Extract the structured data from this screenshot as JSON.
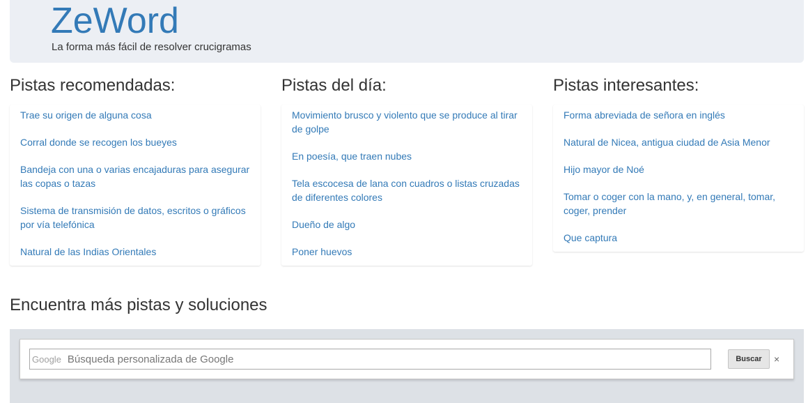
{
  "header": {
    "brand": "ZeWord",
    "tagline": "La forma más fácil de resolver crucigramas"
  },
  "columns": [
    {
      "title": "Pistas recomendadas:",
      "items": [
        "Trae su origen de alguna cosa",
        "Corral donde se recogen los bueyes",
        "Bandeja con una o varias encajaduras para asegurar las copas o tazas",
        "Sistema de transmisión de datos, escritos o gráficos por vía telefónica",
        "Natural de las Indias Orientales"
      ]
    },
    {
      "title": "Pistas del día:",
      "items": [
        "Movimiento brusco y violento que se produce al tirar de golpe",
        "En poesía, que traen nubes",
        "Tela escocesa de lana con cuadros o listas cruzadas de diferentes colores",
        "Dueño de algo",
        "Poner huevos"
      ]
    },
    {
      "title": "Pistas interesantes:",
      "items": [
        "Forma abreviada de señora en inglés",
        "Natural de Nicea, antigua ciudad de Asia Menor",
        "Hijo mayor de Noé",
        "Tomar o coger con la mano, y, en general, tomar, coger, prender",
        "Que captura"
      ]
    }
  ],
  "more": {
    "title": "Encuentra más pistas y soluciones"
  },
  "search": {
    "watermark": "Google",
    "placeholder": "Búsqueda personalizada de Google",
    "button_label": "Buscar",
    "clear_glyph": "×"
  }
}
